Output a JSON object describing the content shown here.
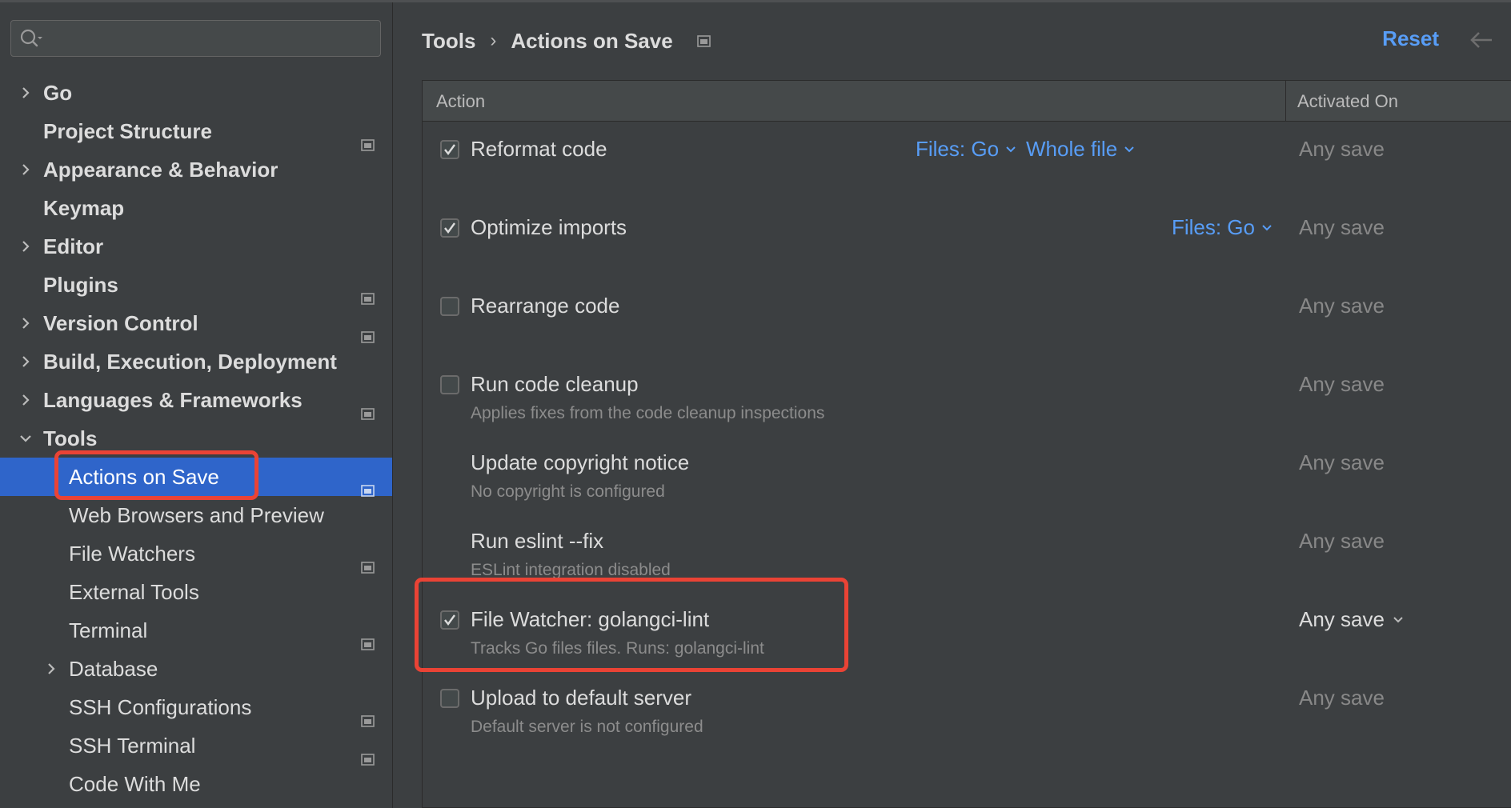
{
  "colors": {
    "accent": "#589df6",
    "selection": "#2f65ca",
    "highlight_box": "#ea4335",
    "background": "#3c3f41"
  },
  "sidebar": {
    "search": {
      "value": "",
      "placeholder": ""
    },
    "items": [
      {
        "label": "Go",
        "expandable": true,
        "expanded": false,
        "pinned": false
      },
      {
        "label": "Project Structure",
        "expandable": false,
        "pinned": true
      },
      {
        "label": "Appearance & Behavior",
        "expandable": true,
        "expanded": false,
        "pinned": false
      },
      {
        "label": "Keymap",
        "expandable": false,
        "pinned": false
      },
      {
        "label": "Editor",
        "expandable": true,
        "expanded": false,
        "pinned": false
      },
      {
        "label": "Plugins",
        "expandable": false,
        "pinned": true
      },
      {
        "label": "Version Control",
        "expandable": true,
        "expanded": false,
        "pinned": true
      },
      {
        "label": "Build, Execution, Deployment",
        "expandable": true,
        "expanded": false,
        "pinned": false
      },
      {
        "label": "Languages & Frameworks",
        "expandable": true,
        "expanded": false,
        "pinned": true
      },
      {
        "label": "Tools",
        "expandable": true,
        "expanded": true,
        "pinned": false
      },
      {
        "label": "Actions on Save",
        "child": true,
        "selected": true,
        "pinned": true
      },
      {
        "label": "Web Browsers and Preview",
        "child": true,
        "pinned": false
      },
      {
        "label": "File Watchers",
        "child": true,
        "pinned": true
      },
      {
        "label": "External Tools",
        "child": true,
        "pinned": false
      },
      {
        "label": "Terminal",
        "child": true,
        "pinned": true
      },
      {
        "label": "Database",
        "child": true,
        "expandable": true,
        "expanded": false,
        "pinned": false
      },
      {
        "label": "SSH Configurations",
        "child": true,
        "pinned": true
      },
      {
        "label": "SSH Terminal",
        "child": true,
        "pinned": true
      },
      {
        "label": "Code With Me",
        "child": true,
        "pinned": false
      }
    ]
  },
  "header": {
    "breadcrumb": [
      "Tools",
      "Actions on Save"
    ],
    "reset_label": "Reset"
  },
  "table": {
    "columns": {
      "action": "Action",
      "activated_on": "Activated On"
    },
    "rows": [
      {
        "checkbox": "checked",
        "title": "Reformat code",
        "description": "",
        "dropdowns": [
          "Files: Go",
          "Whole file"
        ],
        "activated": "Any save",
        "activated_dropdown": false
      },
      {
        "checkbox": "checked",
        "title": "Optimize imports",
        "description": "",
        "dropdowns": [
          "Files: Go"
        ],
        "activated": "Any save",
        "activated_dropdown": false
      },
      {
        "checkbox": "unchecked",
        "title": "Rearrange code",
        "description": "",
        "dropdowns": [],
        "activated": "Any save",
        "activated_dropdown": false
      },
      {
        "checkbox": "unchecked",
        "title": "Run code cleanup",
        "description": "Applies fixes from the code cleanup inspections",
        "dropdowns": [],
        "activated": "Any save",
        "activated_dropdown": false
      },
      {
        "checkbox": "none",
        "title": "Update copyright notice",
        "description": "No copyright is configured",
        "dropdowns": [],
        "activated": "Any save",
        "activated_dropdown": false
      },
      {
        "checkbox": "none",
        "title": "Run eslint --fix",
        "description": "ESLint integration disabled",
        "dropdowns": [],
        "activated": "Any save",
        "activated_dropdown": false
      },
      {
        "checkbox": "checked",
        "title": "File Watcher: golangci-lint",
        "description": "Tracks Go files files. Runs: golangci-lint",
        "dropdowns": [],
        "activated": "Any save",
        "activated_dropdown": true
      },
      {
        "checkbox": "unchecked",
        "title": "Upload to default server",
        "description": "Default server is not configured",
        "dropdowns": [],
        "activated": "Any save",
        "activated_dropdown": false
      }
    ]
  }
}
